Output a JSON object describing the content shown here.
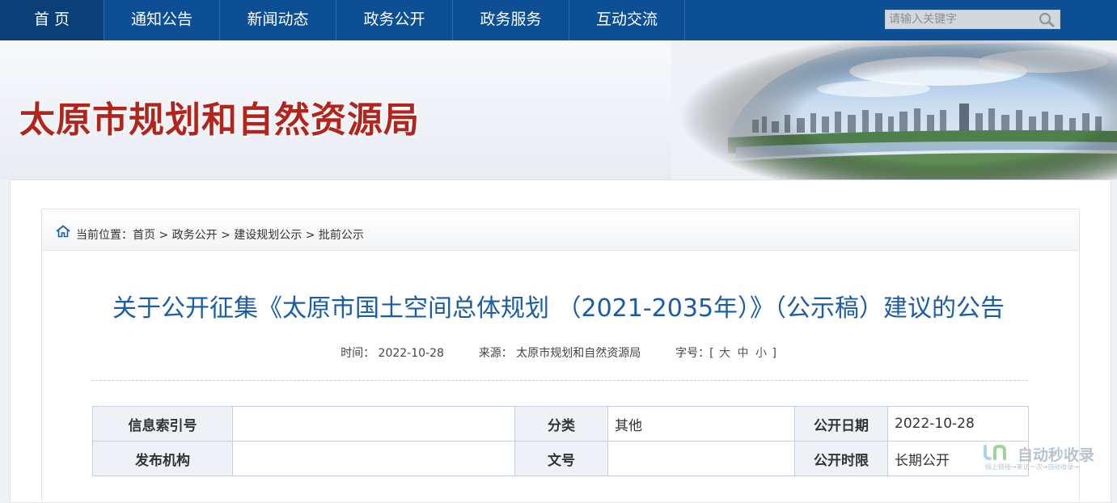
{
  "nav": {
    "items": [
      "首 页",
      "通知公告",
      "新闻动态",
      "政务公开",
      "政务服务",
      "互动交流"
    ],
    "search_placeholder": "请输入关键字"
  },
  "banner": {
    "title": "太原市规划和自然资源局"
  },
  "breadcrumb": {
    "prefix": "当前位置：",
    "items": [
      "首页",
      "政务公开",
      "建设规划公示",
      "批前公示"
    ],
    "separator": ">"
  },
  "article": {
    "title": "关于公开征集《太原市国土空间总体规划 （2021-2035年）》（公示稿）建议的公告",
    "time_label": "时间：",
    "time": "2022-10-28",
    "source_label": "来源：",
    "source": "太原市规划和自然资源局",
    "fontsize_label": "字号：[",
    "fontsize_options": [
      "大",
      "中",
      "小"
    ],
    "fontsize_close": "]"
  },
  "info_table": {
    "rows": [
      [
        {
          "k": "信息索引号",
          "v": ""
        },
        {
          "k": "分类",
          "v": "其他"
        },
        {
          "k": "公开日期",
          "v": "2022-10-28"
        }
      ],
      [
        {
          "k": "发布机构",
          "v": ""
        },
        {
          "k": "文号",
          "v": ""
        },
        {
          "k": "公开时限",
          "v": "长期公开"
        }
      ]
    ]
  },
  "watermark": {
    "text": "自动秒收录",
    "sub": "极上链接→来访一次→自动收录→"
  },
  "colors": {
    "nav_bg": "#0d4f95",
    "title_red": "#b3251c",
    "article_blue": "#1a5ca5"
  }
}
